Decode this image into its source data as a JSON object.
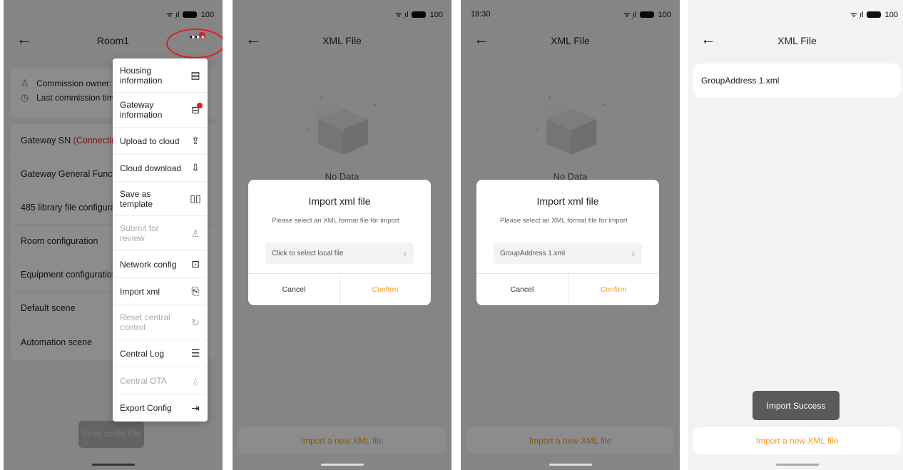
{
  "status": {
    "time": "18:30",
    "signal": "ᯤ ᷊ıl",
    "battery": "100"
  },
  "screen1": {
    "title": "Room1",
    "info": {
      "owner_label": "Commission owner:",
      "last_commission_label": "Last commission tim"
    },
    "rows": {
      "gateway_sn": "Gateway SN",
      "gateway_sn_status": "(Connectin",
      "gateway_general": "Gateway General Functio",
      "lib485": "485 library file configura",
      "room_config": "Room configuration",
      "equipment_config": "Equipment configuration",
      "default_scene": "Default scene",
      "automation_scene": "Automation scene"
    },
    "send_button": "Send config File",
    "menu": {
      "housing": "Housing information",
      "gateway": "Gateway information",
      "upload": "Upload to cloud",
      "download": "Cloud download",
      "save_template": "Save as template",
      "submit_review": "Submit for review",
      "network": "Network config",
      "import_xml": "Import xml",
      "reset_central": "Reset central control",
      "central_log": "Central Log",
      "central_ota": "Central OTA",
      "export_config": "Export Config"
    }
  },
  "xml_screen": {
    "title": "XML File",
    "no_data": "No Data",
    "import_button": "Import a new XML file"
  },
  "dialog": {
    "title": "Import xml file",
    "message": "Please select an XML format file for import",
    "placeholder": "Click to select local file",
    "selected_file": "GroupAddress 1.xml",
    "cancel": "Cancel",
    "confirm": "Confirm"
  },
  "screen4": {
    "file_name": "GroupAddress 1.xml",
    "toast": "Import Success"
  },
  "colors": {
    "accent": "#f0a020",
    "error_red": "#e02020",
    "info_blue": "#4a78c8"
  }
}
